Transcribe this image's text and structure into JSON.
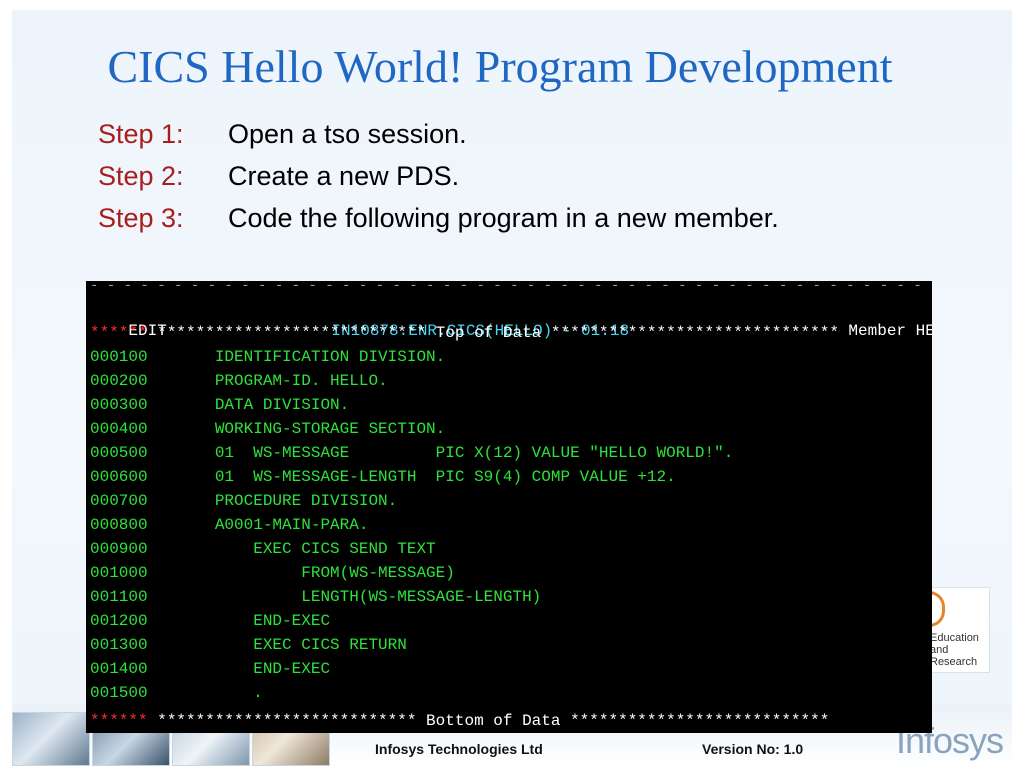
{
  "slide": {
    "title": "CICS Hello World! Program Development",
    "steps": [
      {
        "label": "Step 1:",
        "text": "Open a tso session."
      },
      {
        "label": "Step 2:",
        "text": "Create a new PDS."
      },
      {
        "label": "Step 3:",
        "text": "Code the following program in a new member."
      }
    ]
  },
  "terminal": {
    "dash_line": "- - - - - - - - - - - - - - - - - - - - - - - - - - - - - - - - - - - - - - - - - - - - - - - - - - - - - - - - - - - - - - - - - - - - - - - - - - - - - - -",
    "header": {
      "mode": "EDIT",
      "dataset": "IN10878.ENR.CICS(HELLO) - 01.18",
      "status": "Member HELLO saved"
    },
    "top": {
      "marker": "******",
      "text": " **************************** Top of Data ******************************"
    },
    "lines": [
      {
        "num": "000100",
        "code": "       IDENTIFICATION DIVISION."
      },
      {
        "num": "000200",
        "code": "       PROGRAM-ID. HELLO."
      },
      {
        "num": "000300",
        "code": "       DATA DIVISION."
      },
      {
        "num": "000400",
        "code": "       WORKING-STORAGE SECTION."
      },
      {
        "num": "000500",
        "code": "       01  WS-MESSAGE         PIC X(12) VALUE \"HELLO WORLD!\"."
      },
      {
        "num": "000600",
        "code": "       01  WS-MESSAGE-LENGTH  PIC S9(4) COMP VALUE +12."
      },
      {
        "num": "000700",
        "code": "       PROCEDURE DIVISION."
      },
      {
        "num": "000800",
        "code": "       A0001-MAIN-PARA."
      },
      {
        "num": "000900",
        "code": "           EXEC CICS SEND TEXT"
      },
      {
        "num": "001000",
        "code": "                FROM(WS-MESSAGE)"
      },
      {
        "num": "001100",
        "code": "                LENGTH(WS-MESSAGE-LENGTH)"
      },
      {
        "num": "001200",
        "code": "           END-EXEC"
      },
      {
        "num": "001300",
        "code": "           EXEC CICS RETURN"
      },
      {
        "num": "001400",
        "code": "           END-EXEC"
      },
      {
        "num": "001500",
        "code": "           ."
      }
    ],
    "bottom": {
      "marker": "******",
      "text": " *************************** Bottom of Data ***************************"
    }
  },
  "branding": {
    "edu_text": "Education\nand\nResearch",
    "company": "Infosys Technologies Ltd",
    "version": "Version No: 1.0",
    "logo": "Infosys"
  }
}
